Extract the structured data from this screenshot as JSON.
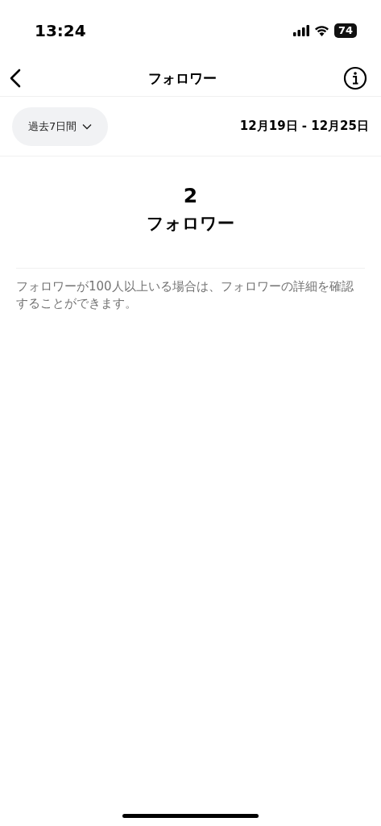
{
  "status_bar": {
    "time": "13:24",
    "battery": "74"
  },
  "header": {
    "title": "フォロワー"
  },
  "filter": {
    "period": "過去7日間",
    "date_range": "12月19日 - 12月25日"
  },
  "summary": {
    "count": "2",
    "label": "フォロワー"
  },
  "note": "フォロワーが100人以上いる場合は、フォロワーの詳細を確認することができます。"
}
